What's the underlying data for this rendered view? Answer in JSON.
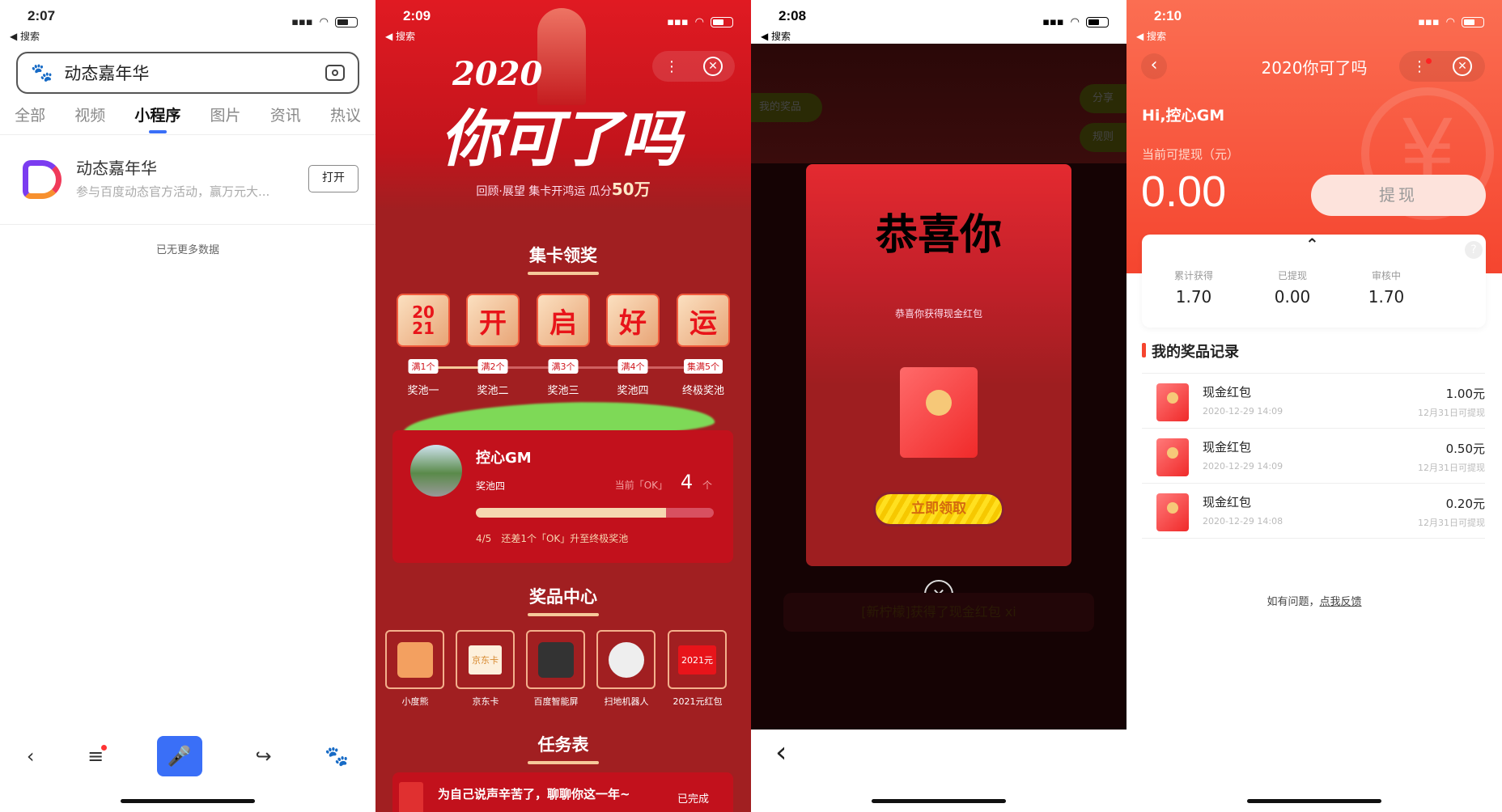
{
  "panel1": {
    "status": {
      "time": "2:07",
      "back": "◀ 搜索"
    },
    "search": {
      "value": "动态嘉年华"
    },
    "tabs": [
      {
        "label": "全部"
      },
      {
        "label": "视频"
      },
      {
        "label": "小程序",
        "active": true
      },
      {
        "label": "图片"
      },
      {
        "label": "资讯"
      },
      {
        "label": "热议"
      }
    ],
    "result": {
      "title": "动态嘉年华",
      "desc": "参与百度动态官方活动，赢万元大...",
      "open_label": "打开"
    },
    "no_more": "已无更多数据",
    "accent": "#3a6ff7"
  },
  "panel2": {
    "status": {
      "time": "2:09",
      "back": "◀ 搜索"
    },
    "banner": {
      "year": "2020",
      "title": "你可了吗",
      "subtitle": "回顾·展望  集卡开鸿运  瓜分",
      "amount": "50万"
    },
    "collect_title": "集卡领奖",
    "cards": [
      {
        "char": "20 21",
        "badge": "满1个",
        "label": "奖池一"
      },
      {
        "char": "开",
        "badge": "满2个",
        "label": "奖池二"
      },
      {
        "char": "启",
        "badge": "满3个",
        "label": "奖池三"
      },
      {
        "char": "好",
        "badge": "满4个",
        "label": "奖池四"
      },
      {
        "char": "运",
        "badge": "集满5个",
        "label": "终极奖池"
      }
    ],
    "user": {
      "name": "控心GM",
      "pool": "奖池四",
      "current_label": "当前「OK」",
      "count": "4",
      "unit": "个",
      "progress": 0.8,
      "progress_text": "4/5",
      "hint": "还差1个「OK」升至终极奖池"
    },
    "prize_title": "奖品中心",
    "prizes": [
      {
        "label": "小度熊"
      },
      {
        "label": "京东卡",
        "card_text": "京东卡"
      },
      {
        "label": "百度智能屏"
      },
      {
        "label": "扫地机器人"
      },
      {
        "label": "2021元红包",
        "card_text": "2021元"
      }
    ],
    "task_title": "任务表",
    "task": {
      "title": "为自己说声辛苦了，聊聊你这一年~",
      "status": "已完成"
    },
    "bg": "#a11f21"
  },
  "panel3": {
    "status": {
      "time": "2:08",
      "back": "◀ 搜索"
    },
    "bg_buttons": {
      "prizes": "我的奖品",
      "share": "分享",
      "rules": "规则"
    },
    "modal": {
      "title": "恭喜你",
      "subtitle": "恭喜你获得现金红包",
      "claim": "立即领取"
    },
    "ticker": "[新柠檬]获得了现金红包 xi"
  },
  "panel4": {
    "status": {
      "time": "2:10",
      "back": "◀ 搜索"
    },
    "nav_title": "2020你可了吗",
    "greeting": "Hi,控心GM",
    "withdrawable_label": "当前可提现（元）",
    "withdrawable": "0.00",
    "withdraw_button": "提现",
    "stats": [
      {
        "label": "累计获得",
        "value": "1.70"
      },
      {
        "label": "已提现",
        "value": "0.00"
      },
      {
        "label": "审核中",
        "value": "1.70"
      }
    ],
    "records_title": "我的奖品记录",
    "records": [
      {
        "name": "现金红包",
        "time": "2020-12-29 14:09",
        "amount": "1.00元",
        "note": "12月31日可提现"
      },
      {
        "name": "现金红包",
        "time": "2020-12-29 14:09",
        "amount": "0.50元",
        "note": "12月31日可提现"
      },
      {
        "name": "现金红包",
        "time": "2020-12-29 14:08",
        "amount": "0.20元",
        "note": "12月31日可提现"
      }
    ],
    "feedback_prefix": "如有问题，",
    "feedback_link": "点我反馈",
    "accent": "#f5452f"
  }
}
